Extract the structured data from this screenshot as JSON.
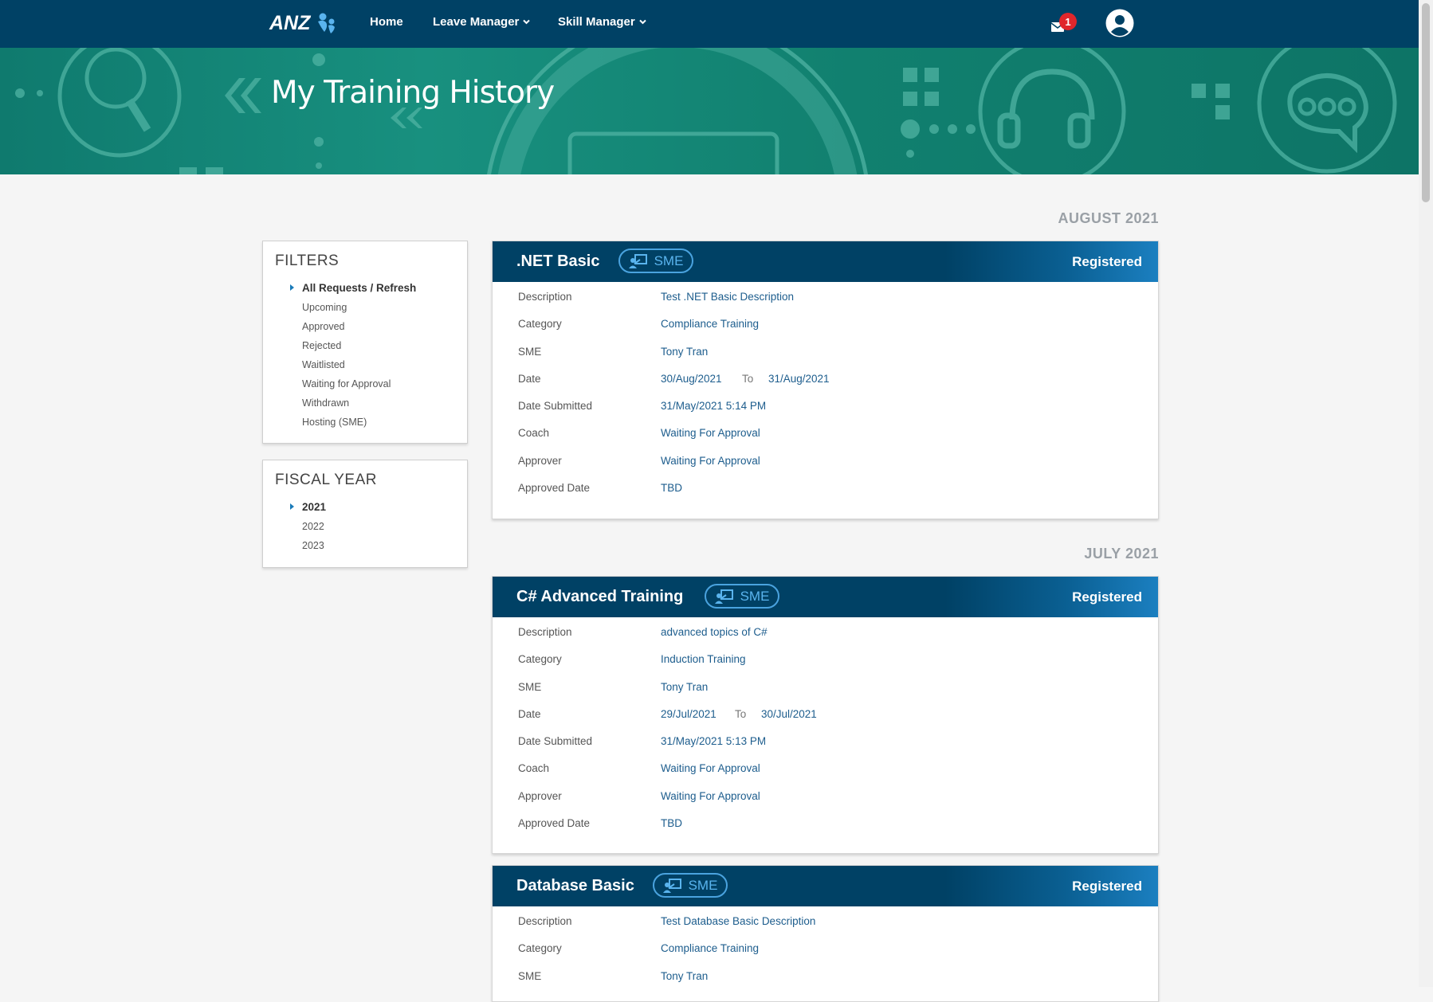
{
  "nav": {
    "logo_text": "ANZ",
    "home": "Home",
    "leave_manager": "Leave Manager",
    "skill_manager": "Skill Manager",
    "notification_count": "1",
    "chevron": "˅"
  },
  "hero": {
    "title": "My Training History"
  },
  "filters": {
    "title": "FILTERS",
    "items": [
      "All Requests / Refresh",
      "Upcoming",
      "Approved",
      "Rejected",
      "Waitlisted",
      "Waiting for Approval",
      "Withdrawn",
      "Hosting (SME)"
    ],
    "active_index": 0
  },
  "fiscal_year": {
    "title": "FISCAL YEAR",
    "items": [
      "2021",
      "2022",
      "2023"
    ],
    "active_index": 0
  },
  "months": [
    "AUGUST 2021",
    "JULY 2021"
  ],
  "labels": {
    "description": "Description",
    "category": "Category",
    "sme": "SME",
    "date": "Date",
    "to": "To",
    "date_submitted": "Date Submitted",
    "coach": "Coach",
    "approver": "Approver",
    "approved_date": "Approved Date",
    "sme_badge": "SME"
  },
  "trainings": [
    {
      "title": ".NET Basic",
      "status": "Registered",
      "description": "Test .NET Basic Description",
      "category": "Compliance Training",
      "sme": "Tony Tran",
      "date_from": "30/Aug/2021",
      "date_to": "31/Aug/2021",
      "date_submitted": "31/May/2021 5:14 PM",
      "coach": "Waiting For Approval",
      "approver": "Waiting For Approval",
      "approved_date": "TBD"
    },
    {
      "title": "C# Advanced Training",
      "status": "Registered",
      "description": "advanced topics of C#",
      "category": "Induction Training",
      "sme": "Tony Tran",
      "date_from": "29/Jul/2021",
      "date_to": "30/Jul/2021",
      "date_submitted": "31/May/2021 5:13 PM",
      "coach": "Waiting For Approval",
      "approver": "Waiting For Approval",
      "approved_date": "TBD"
    },
    {
      "title": "Database Basic",
      "status": "Registered",
      "description": "Test Database Basic Description",
      "category": "Compliance Training",
      "sme": "Tony Tran"
    }
  ],
  "colors": {
    "nav_bg": "#004165",
    "hero_bg": "#17907f",
    "link_value": "#1d5d8d",
    "sme_pill": "#4aa3df",
    "badge": "#e0262b"
  }
}
